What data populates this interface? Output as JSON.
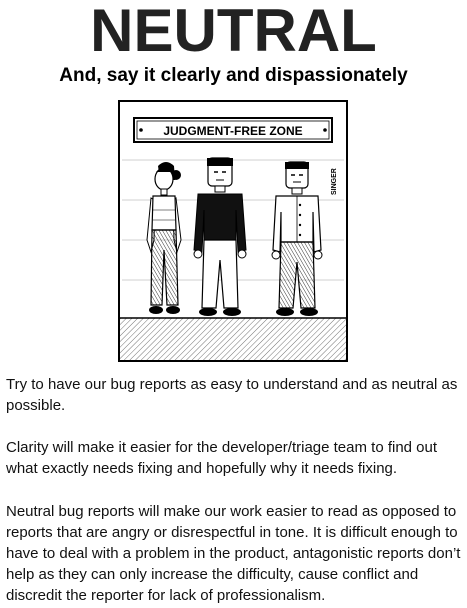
{
  "title": "NEUTRAL",
  "subtitle": "And, say it clearly and dispassionately",
  "cartoon": {
    "sign_text": "JUDGMENT-FREE ZONE",
    "artist_signature": "SINGER"
  },
  "paragraphs": [
    "Try to have our bug reports as easy to understand and as neutral as possible.",
    "Clarity will make it easier for the developer/triage team to find out what exactly needs fixing and hopefully why it needs fixing.",
    "Neutral bug reports will make our work easier to read as opposed to reports that are angry or disrespectful in tone. It is difficult enough to have to deal with a problem in the product, antagonistic reports don’t help as they can only increase the difficulty, cause conflict and discredit the reporter for lack of professionalism."
  ]
}
